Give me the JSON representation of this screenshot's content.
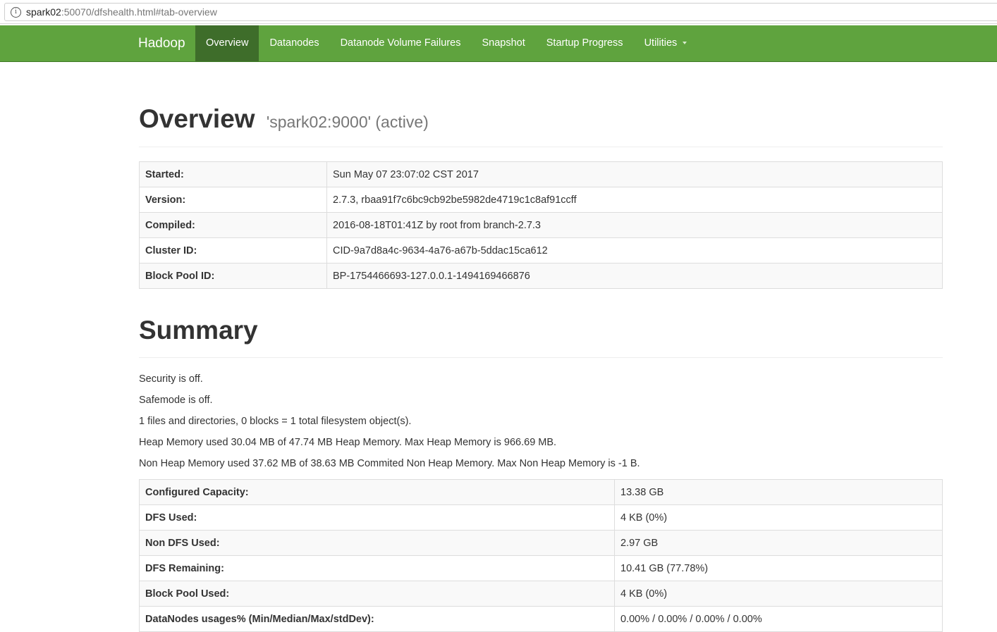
{
  "address_bar": {
    "host": "spark02",
    "rest": ":50070/dfshealth.html#tab-overview"
  },
  "navbar": {
    "brand": "Hadoop",
    "items": [
      {
        "label": "Overview",
        "active": true
      },
      {
        "label": "Datanodes"
      },
      {
        "label": "Datanode Volume Failures"
      },
      {
        "label": "Snapshot"
      },
      {
        "label": "Startup Progress"
      },
      {
        "label": "Utilities",
        "dropdown": true
      }
    ],
    "color": "#5fa33e",
    "active_color": "#3e6d2a"
  },
  "overview": {
    "title": "Overview",
    "subtitle": "'spark02:9000' (active)",
    "rows": [
      {
        "key": "Started:",
        "value": "Sun May 07 23:07:02 CST 2017"
      },
      {
        "key": "Version:",
        "value": "2.7.3, rbaa91f7c6bc9cb92be5982de4719c1c8af91ccff"
      },
      {
        "key": "Compiled:",
        "value": "2016-08-18T01:41Z by root from branch-2.7.3"
      },
      {
        "key": "Cluster ID:",
        "value": "CID-9a7d8a4c-9634-4a76-a67b-5ddac15ca612"
      },
      {
        "key": "Block Pool ID:",
        "value": "BP-1754466693-127.0.0.1-1494169466876"
      }
    ]
  },
  "summary": {
    "title": "Summary",
    "lines": [
      "Security is off.",
      "Safemode is off.",
      "1 files and directories, 0 blocks = 1 total filesystem object(s).",
      "Heap Memory used 30.04 MB of 47.74 MB Heap Memory. Max Heap Memory is 966.69 MB.",
      "Non Heap Memory used 37.62 MB of 38.63 MB Commited Non Heap Memory. Max Non Heap Memory is -1 B."
    ],
    "rows": [
      {
        "key": "Configured Capacity:",
        "value": "13.38 GB"
      },
      {
        "key": "DFS Used:",
        "value": "4 KB (0%)"
      },
      {
        "key": "Non DFS Used:",
        "value": "2.97 GB"
      },
      {
        "key": "DFS Remaining:",
        "value": "10.41 GB (77.78%)"
      },
      {
        "key": "Block Pool Used:",
        "value": "4 KB (0%)"
      },
      {
        "key": "DataNodes usages% (Min/Median/Max/stdDev):",
        "value": "0.00% / 0.00% / 0.00% / 0.00%"
      }
    ]
  }
}
